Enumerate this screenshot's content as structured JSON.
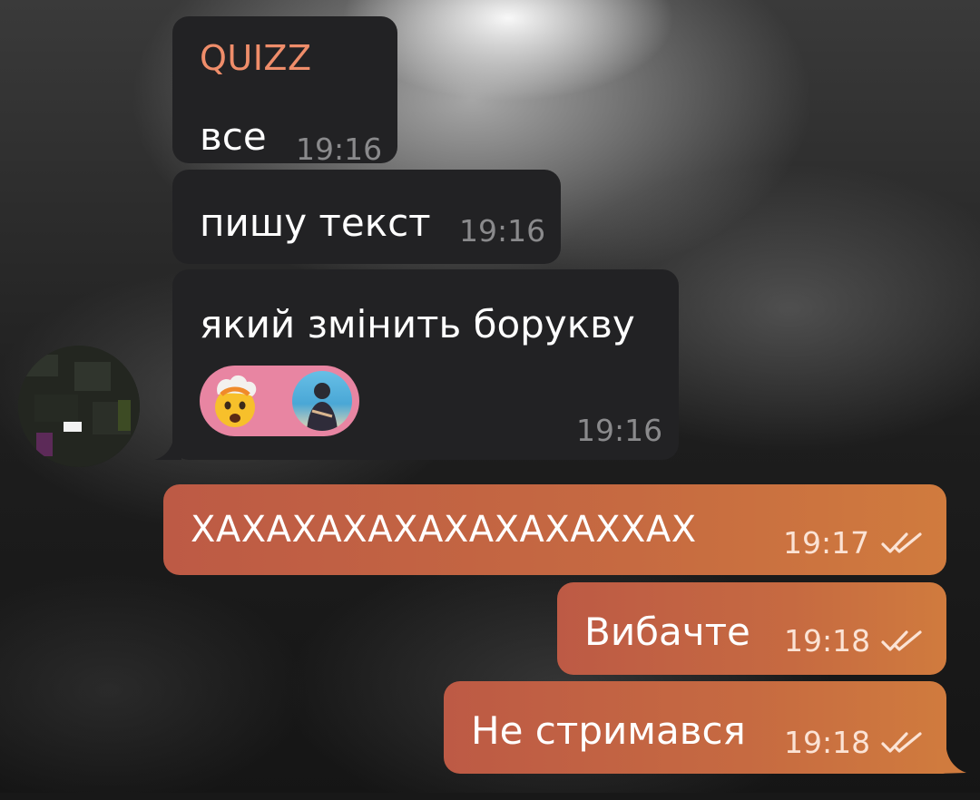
{
  "chat": {
    "incoming": [
      {
        "sender": "QUIZZ",
        "text": "все",
        "time": "19:16"
      },
      {
        "text": "пишу текст",
        "time": "19:16"
      },
      {
        "text": "який змінить борукву",
        "time": "19:16",
        "reactions": [
          "exploding-head-emoji",
          "user-photo"
        ]
      }
    ],
    "outgoing": [
      {
        "text": "ХАХАХАХАХАХАХАХАХХАХ",
        "time": "19:17",
        "status": "read"
      },
      {
        "text": "Вибачте",
        "time": "19:18",
        "status": "read"
      },
      {
        "text": "Не стримався",
        "time": "19:18",
        "status": "read"
      }
    ]
  },
  "colors": {
    "incoming_bubble": "#222224",
    "outgoing_bubble_start": "#bd5a45",
    "outgoing_bubble_end": "#d07b3e",
    "sender_name": "#ef8d6a",
    "reaction_pill": "#e885a2"
  }
}
